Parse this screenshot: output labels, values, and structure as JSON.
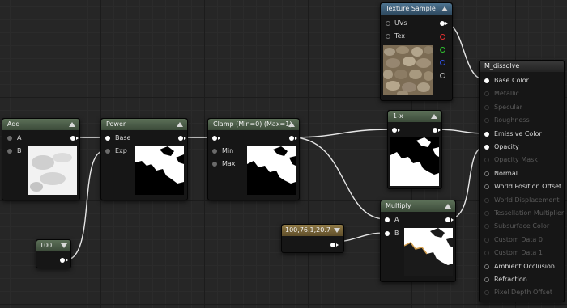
{
  "nodes": {
    "texture_sample": {
      "title": "Texture Sample",
      "inputs": [
        "UVs",
        "Tex"
      ]
    },
    "add": {
      "title": "Add",
      "inputs": [
        "A",
        "B"
      ]
    },
    "power": {
      "title": "Power",
      "inputs": [
        "Base",
        "Exp"
      ]
    },
    "clamp": {
      "title": "Clamp (Min=0) (Max=1)",
      "inputs": [
        "Min",
        "Max"
      ]
    },
    "one_minus": {
      "title": "1-x"
    },
    "multiply": {
      "title": "Multiply",
      "inputs": [
        "A",
        "B"
      ]
    },
    "constant": {
      "value": "100"
    },
    "vector": {
      "value": "100,76.1,20.7"
    }
  },
  "material": {
    "title": "M_dissolve",
    "pins": [
      {
        "label": "Base Color",
        "state": "connected"
      },
      {
        "label": "Metallic",
        "state": "disabled"
      },
      {
        "label": "Specular",
        "state": "disabled"
      },
      {
        "label": "Roughness",
        "state": "disabled"
      },
      {
        "label": "Emissive Color",
        "state": "connected"
      },
      {
        "label": "Opacity",
        "state": "connected"
      },
      {
        "label": "Opacity Mask",
        "state": "disabled"
      },
      {
        "label": "Normal",
        "state": "enabled"
      },
      {
        "label": "World Position Offset",
        "state": "enabled"
      },
      {
        "label": "World Displacement",
        "state": "disabled"
      },
      {
        "label": "Tessellation Multiplier",
        "state": "disabled"
      },
      {
        "label": "Subsurface Color",
        "state": "disabled"
      },
      {
        "label": "Custom Data 0",
        "state": "disabled"
      },
      {
        "label": "Custom Data 1",
        "state": "disabled"
      },
      {
        "label": "Ambient Occlusion",
        "state": "enabled"
      },
      {
        "label": "Refraction",
        "state": "enabled"
      },
      {
        "label": "Pixel Depth Offset",
        "state": "disabled"
      }
    ]
  },
  "colors": {
    "wire": "#e6e6e6",
    "pin_red": "#e03030",
    "pin_green": "#30c030",
    "pin_blue": "#3050e0",
    "pin_alpha": "#b0b0b0"
  }
}
